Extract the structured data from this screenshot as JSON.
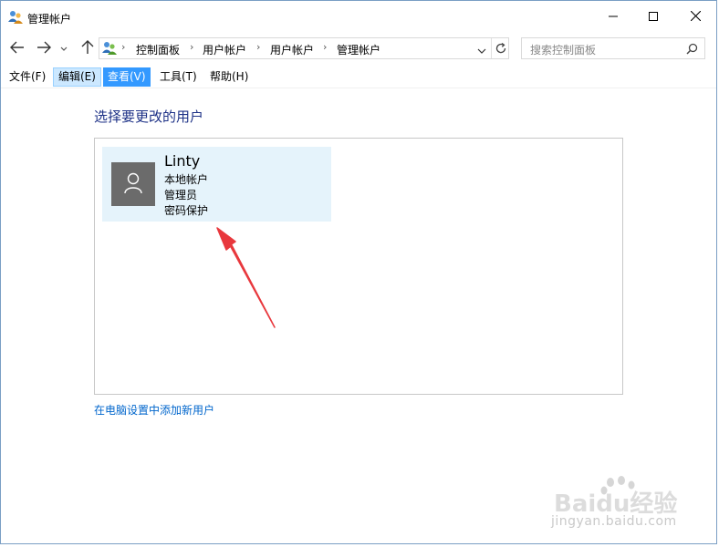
{
  "window": {
    "title": "管理帐户",
    "minimize_icon": "minimize-icon",
    "maximize_icon": "maximize-icon",
    "close_icon": "close-icon"
  },
  "navigation": {
    "back_icon": "arrow-left-icon",
    "forward_icon": "arrow-right-icon",
    "recent_icon": "chevron-down-icon",
    "up_icon": "arrow-up-icon",
    "breadcrumb": [
      "控制面板",
      "用户帐户",
      "用户帐户",
      "管理帐户"
    ],
    "refresh_icon": "refresh-icon"
  },
  "search": {
    "placeholder": "搜索控制面板",
    "icon": "search-icon"
  },
  "menu": {
    "items": [
      {
        "label": "文件(F)",
        "state": "normal"
      },
      {
        "label": "编辑(E)",
        "state": "hover"
      },
      {
        "label": "查看(V)",
        "state": "active"
      },
      {
        "label": "工具(T)",
        "state": "normal"
      },
      {
        "label": "帮助(H)",
        "state": "normal"
      }
    ]
  },
  "main": {
    "heading": "选择要更改的用户",
    "users": [
      {
        "name": "Linty",
        "details": [
          "本地帐户",
          "管理员",
          "密码保护"
        ],
        "avatar_icon": "user-icon"
      }
    ],
    "add_user_link": "在电脑设置中添加新用户"
  },
  "watermark": {
    "logo_text": "Baidu经验",
    "url_text": "jingyan.baidu.com"
  },
  "colors": {
    "heading": "#1e3287",
    "link": "#0066cc",
    "tile_bg": "#e5f3fb",
    "menu_active": "#3399ff",
    "arrow": "#e8383d"
  }
}
